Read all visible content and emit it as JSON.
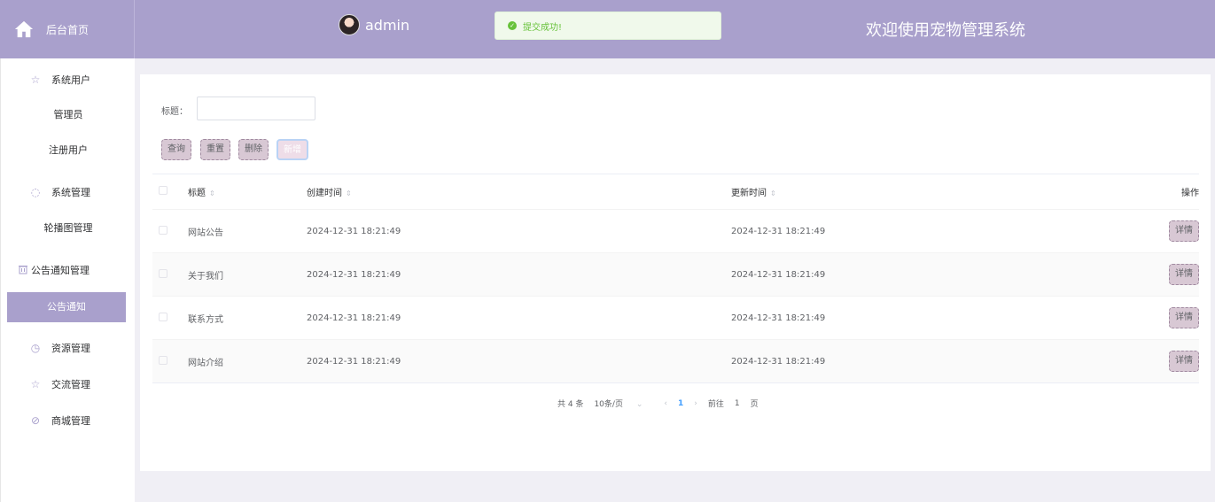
{
  "header": {
    "home_label": "后台首页",
    "username": "admin",
    "toast": "提交成功!",
    "welcome": "欢迎使用宠物管理系统"
  },
  "sidebar": {
    "groups": [
      {
        "label": "系统用户",
        "icon": "star-icon"
      },
      {
        "label": "系统管理",
        "icon": "cube-icon"
      },
      {
        "label": "公告通知管理",
        "icon": "trash-icon"
      },
      {
        "label": "资源管理",
        "icon": "clock-icon"
      },
      {
        "label": "交流管理",
        "icon": "star-icon"
      },
      {
        "label": "商城管理",
        "icon": "compass-icon"
      }
    ],
    "items": [
      "管理员",
      "注册用户",
      "轮播图管理",
      "公告通知"
    ]
  },
  "search": {
    "label": "标题：",
    "value": ""
  },
  "toolbar": {
    "query": "查询",
    "reset": "重置",
    "delete": "删除",
    "add": "新增"
  },
  "table": {
    "columns": [
      "标题",
      "创建时间",
      "更新时间",
      "操作"
    ],
    "rows": [
      {
        "title": "网站公告",
        "created": "2024-12-31 18:21:49",
        "updated": "2024-12-31 18:21:49",
        "action": "详情"
      },
      {
        "title": "关于我们",
        "created": "2024-12-31 18:21:49",
        "updated": "2024-12-31 18:21:49",
        "action": "详情"
      },
      {
        "title": "联系方式",
        "created": "2024-12-31 18:21:49",
        "updated": "2024-12-31 18:21:49",
        "action": "详情"
      },
      {
        "title": "网站介绍",
        "created": "2024-12-31 18:21:49",
        "updated": "2024-12-31 18:21:49",
        "action": "详情"
      }
    ]
  },
  "pagination": {
    "total": "共 4 条",
    "page_size": "10条/页",
    "current_page": "1",
    "goto_label": "前往",
    "goto_value": "1",
    "page_suffix": "页"
  },
  "colors": {
    "header_bg": "#a9a0cc",
    "button_bg": "#d8c8d4",
    "success": "#67c23a"
  }
}
